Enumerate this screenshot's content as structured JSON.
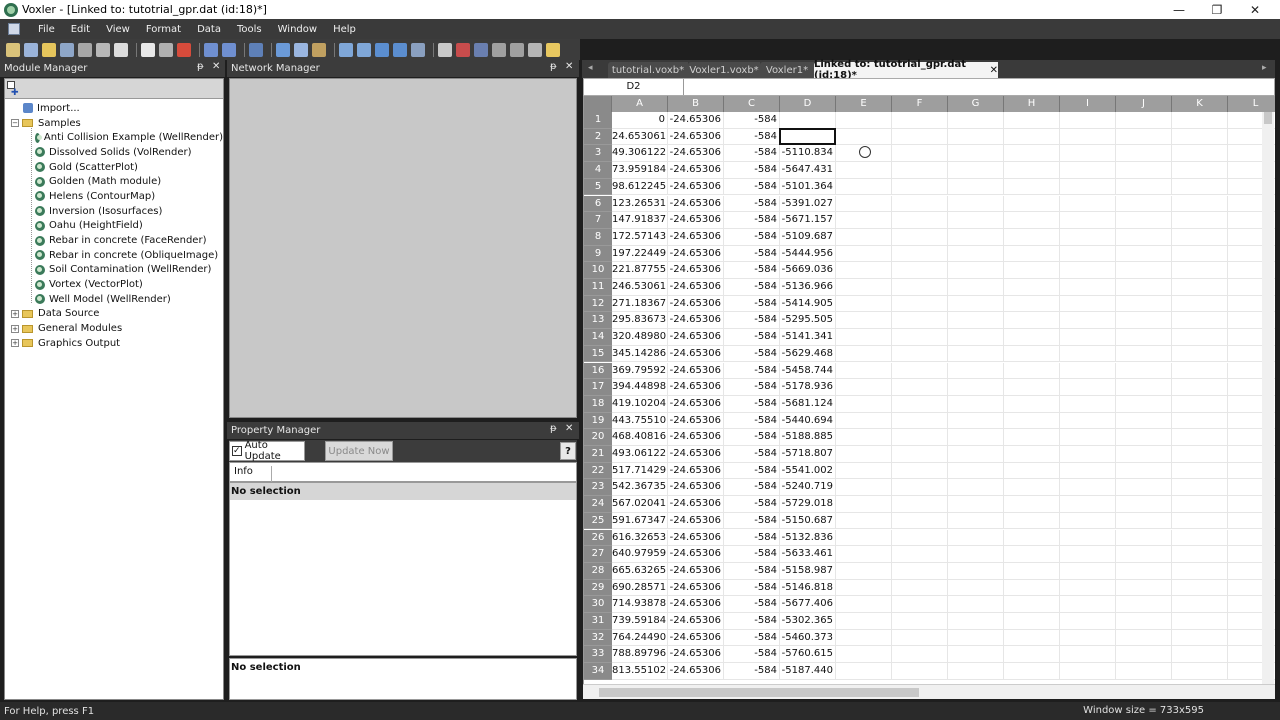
{
  "window": {
    "title": "Voxler - [Linked to: tutotrial_gpr.dat (id:18)*]",
    "minimize": "—",
    "restore": "❐",
    "close": "✕"
  },
  "menu": [
    "File",
    "Edit",
    "View",
    "Format",
    "Data",
    "Tools",
    "Window",
    "Help"
  ],
  "module_manager": {
    "title": "Module Manager",
    "tree": [
      {
        "label": "Import...",
        "kind": "import"
      },
      {
        "label": "Samples",
        "kind": "folder",
        "expanded": true
      },
      {
        "label": "Anti Collision Example (WellRender)",
        "kind": "module"
      },
      {
        "label": "Dissolved Solids (VolRender)",
        "kind": "module"
      },
      {
        "label": "Gold (ScatterPlot)",
        "kind": "module"
      },
      {
        "label": "Golden (Math module)",
        "kind": "module"
      },
      {
        "label": "Helens (ContourMap)",
        "kind": "module"
      },
      {
        "label": "Inversion (Isosurfaces)",
        "kind": "module"
      },
      {
        "label": "Oahu (HeightField)",
        "kind": "module"
      },
      {
        "label": "Rebar in concrete (FaceRender)",
        "kind": "module"
      },
      {
        "label": "Rebar in concrete (ObliqueImage)",
        "kind": "module"
      },
      {
        "label": "Soil Contamination (WellRender)",
        "kind": "module"
      },
      {
        "label": "Vortex (VectorPlot)",
        "kind": "module"
      },
      {
        "label": "Well Model (WellRender)",
        "kind": "module"
      },
      {
        "label": "Data Source",
        "kind": "folder",
        "expanded": false
      },
      {
        "label": "General Modules",
        "kind": "folder",
        "expanded": false
      },
      {
        "label": "Graphics Output",
        "kind": "folder",
        "expanded": false
      }
    ]
  },
  "network_manager": {
    "title": "Network Manager"
  },
  "property_manager": {
    "title": "Property Manager",
    "auto_update": "Auto Update",
    "update_now": "Update Now",
    "help": "?",
    "info_tab": "Info",
    "no_selection_top": "No selection",
    "no_selection_bottom": "No selection"
  },
  "tabs": [
    {
      "label": "tutotrial.voxb*",
      "active": false
    },
    {
      "label": "Voxler1.voxb*",
      "active": false
    },
    {
      "label": "Voxler1*",
      "active": false
    },
    {
      "label": "Linked to: tutotrial_gpr.dat (id:18)*",
      "active": true
    }
  ],
  "sheet": {
    "cell_ref": "D2",
    "columns": [
      "A",
      "B",
      "C",
      "D",
      "E",
      "F",
      "G",
      "H",
      "I",
      "J",
      "K",
      "L"
    ],
    "rows": [
      [
        "0",
        "-24.65306",
        "-584",
        ""
      ],
      [
        "24.653061",
        "-24.65306",
        "-584",
        ""
      ],
      [
        "49.306122",
        "-24.65306",
        "-584",
        "-5110.834"
      ],
      [
        "73.959184",
        "-24.65306",
        "-584",
        "-5647.431"
      ],
      [
        "98.612245",
        "-24.65306",
        "-584",
        "-5101.364"
      ],
      [
        "123.26531",
        "-24.65306",
        "-584",
        "-5391.027"
      ],
      [
        "147.91837",
        "-24.65306",
        "-584",
        "-5671.157"
      ],
      [
        "172.57143",
        "-24.65306",
        "-584",
        "-5109.687"
      ],
      [
        "197.22449",
        "-24.65306",
        "-584",
        "-5444.956"
      ],
      [
        "221.87755",
        "-24.65306",
        "-584",
        "-5669.036"
      ],
      [
        "246.53061",
        "-24.65306",
        "-584",
        "-5136.966"
      ],
      [
        "271.18367",
        "-24.65306",
        "-584",
        "-5414.905"
      ],
      [
        "295.83673",
        "-24.65306",
        "-584",
        "-5295.505"
      ],
      [
        "320.48980",
        "-24.65306",
        "-584",
        "-5141.341"
      ],
      [
        "345.14286",
        "-24.65306",
        "-584",
        "-5629.468"
      ],
      [
        "369.79592",
        "-24.65306",
        "-584",
        "-5458.744"
      ],
      [
        "394.44898",
        "-24.65306",
        "-584",
        "-5178.936"
      ],
      [
        "419.10204",
        "-24.65306",
        "-584",
        "-5681.124"
      ],
      [
        "443.75510",
        "-24.65306",
        "-584",
        "-5440.694"
      ],
      [
        "468.40816",
        "-24.65306",
        "-584",
        "-5188.885"
      ],
      [
        "493.06122",
        "-24.65306",
        "-584",
        "-5718.807"
      ],
      [
        "517.71429",
        "-24.65306",
        "-584",
        "-5541.002"
      ],
      [
        "542.36735",
        "-24.65306",
        "-584",
        "-5240.719"
      ],
      [
        "567.02041",
        "-24.65306",
        "-584",
        "-5729.018"
      ],
      [
        "591.67347",
        "-24.65306",
        "-584",
        "-5150.687"
      ],
      [
        "616.32653",
        "-24.65306",
        "-584",
        "-5132.836"
      ],
      [
        "640.97959",
        "-24.65306",
        "-584",
        "-5633.461"
      ],
      [
        "665.63265",
        "-24.65306",
        "-584",
        "-5158.987"
      ],
      [
        "690.28571",
        "-24.65306",
        "-584",
        "-5146.818"
      ],
      [
        "714.93878",
        "-24.65306",
        "-584",
        "-5677.406"
      ],
      [
        "739.59184",
        "-24.65306",
        "-584",
        "-5302.365"
      ],
      [
        "764.24490",
        "-24.65306",
        "-584",
        "-5460.373"
      ],
      [
        "788.89796",
        "-24.65306",
        "-584",
        "-5760.615"
      ],
      [
        "813.55102",
        "-24.65306",
        "-584",
        "-5187.440"
      ]
    ]
  },
  "status": {
    "help": "For Help, press F1",
    "window_size": "Window size = 733x595"
  },
  "colors": {
    "chrome_dark": "#3c3c3c",
    "sheet_header": "#8a8a8a",
    "network_bg": "#c8c8c8"
  }
}
